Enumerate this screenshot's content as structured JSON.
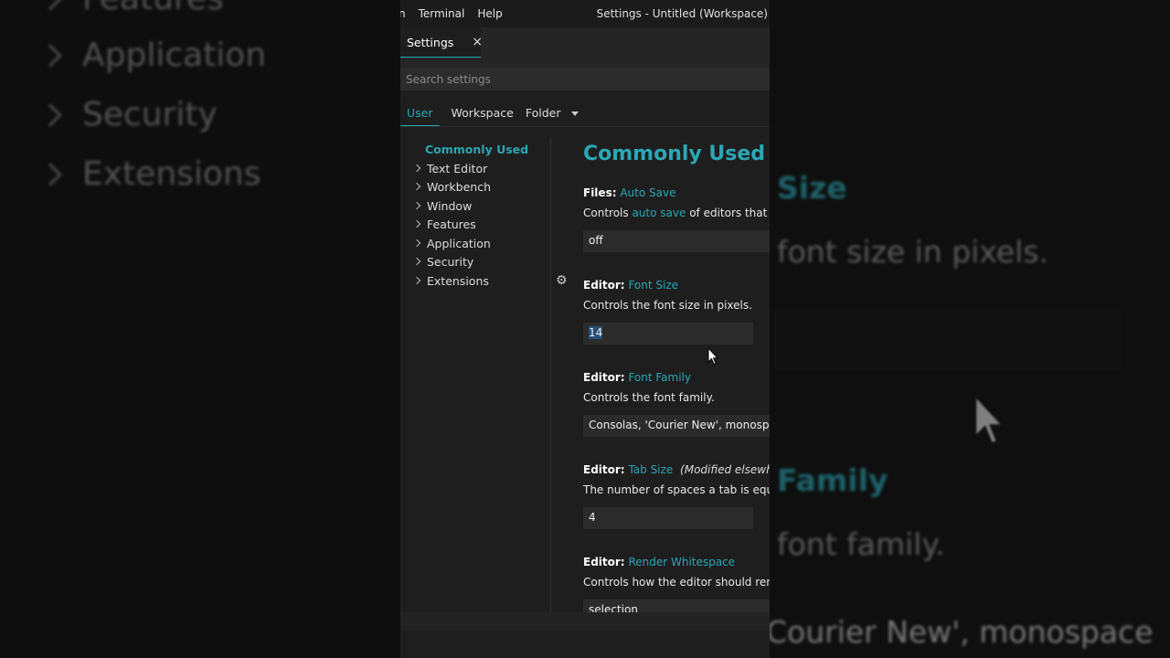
{
  "background_left": {
    "items": [
      "Features",
      "Application",
      "Security",
      "Extensions"
    ]
  },
  "background_right": {
    "size_label": "Size",
    "font_size_desc": "font size in pixels.",
    "family_label": "Family",
    "font_family_desc": "font family.",
    "font_value": "Courier New', monospace"
  },
  "menubar": {
    "items": [
      "n",
      "Terminal",
      "Help"
    ],
    "window_title": "Settings - Untitled (Workspace)"
  },
  "tab": {
    "label": "Settings",
    "close": "×"
  },
  "search": {
    "placeholder": "Search settings"
  },
  "scope_tabs": {
    "user": "User",
    "workspace": "Workspace",
    "folder": "Folder"
  },
  "toc": {
    "items": [
      "Commonly Used",
      "Text Editor",
      "Workbench",
      "Window",
      "Features",
      "Application",
      "Security",
      "Extensions"
    ]
  },
  "content": {
    "title": "Commonly Used",
    "settings": [
      {
        "category": "Files:",
        "name": "Auto Save",
        "desc_pre": "Controls ",
        "desc_link": "auto save",
        "desc_post": " of editors that have",
        "value": "off"
      },
      {
        "category": "Editor:",
        "name": "Font Size",
        "desc": "Controls the font size in pixels.",
        "value": "14"
      },
      {
        "category": "Editor:",
        "name": "Font Family",
        "desc": "Controls the font family.",
        "value": "Consolas, 'Courier New', monospace"
      },
      {
        "category": "Editor:",
        "name": "Tab Size",
        "modified": "(Modified elsewhere)",
        "desc": "The number of spaces a tab is equal to",
        "value": "4"
      },
      {
        "category": "Editor:",
        "name": "Render Whitespace",
        "desc": "Controls how the editor should render",
        "value": "selection"
      }
    ]
  },
  "colors": {
    "accent": "#2aa7b5",
    "editor_bg": "#1e1e1e",
    "sidebar_bg": "#252526"
  }
}
